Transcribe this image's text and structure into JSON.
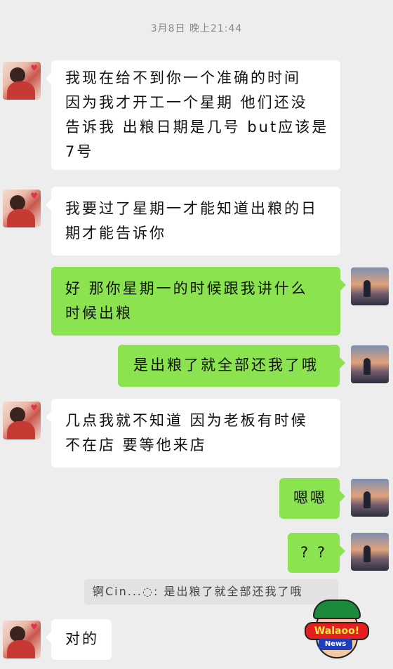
{
  "timestamp": "3月8日 晚上21:44",
  "messages": [
    {
      "side": "left",
      "lines": [
        "我现在给不到你一个准确的时间",
        "因为我才开工一个星期 他们还没",
        "告诉我 出粮日期是几号 but应该是",
        "7号"
      ]
    },
    {
      "side": "left",
      "lines": [
        "我要过了星期一才能知道出粮的日",
        "期才能告诉你"
      ]
    },
    {
      "side": "right",
      "lines": [
        "好 那你星期一的时候跟我讲什么",
        "时候出粮"
      ]
    },
    {
      "side": "right",
      "lines": [
        "是出粮了就全部还我了哦"
      ]
    },
    {
      "side": "left",
      "lines": [
        "几点我就不知道 因为老板有时候",
        "不在店 要等他来店"
      ]
    },
    {
      "side": "right",
      "lines": [
        "嗯嗯"
      ]
    },
    {
      "side": "right",
      "lines": [
        "? ?"
      ]
    },
    {
      "side": "left",
      "lines": [
        "对的"
      ]
    }
  ],
  "quote": {
    "text": "锕Cin...◌: 是出粮了就全部还我了哦"
  },
  "watermark": {
    "brand": "Walaoo!",
    "sub": "News"
  },
  "colors": {
    "background": "#ededed",
    "own_bubble": "#8be44f",
    "other_bubble": "#ffffff"
  }
}
